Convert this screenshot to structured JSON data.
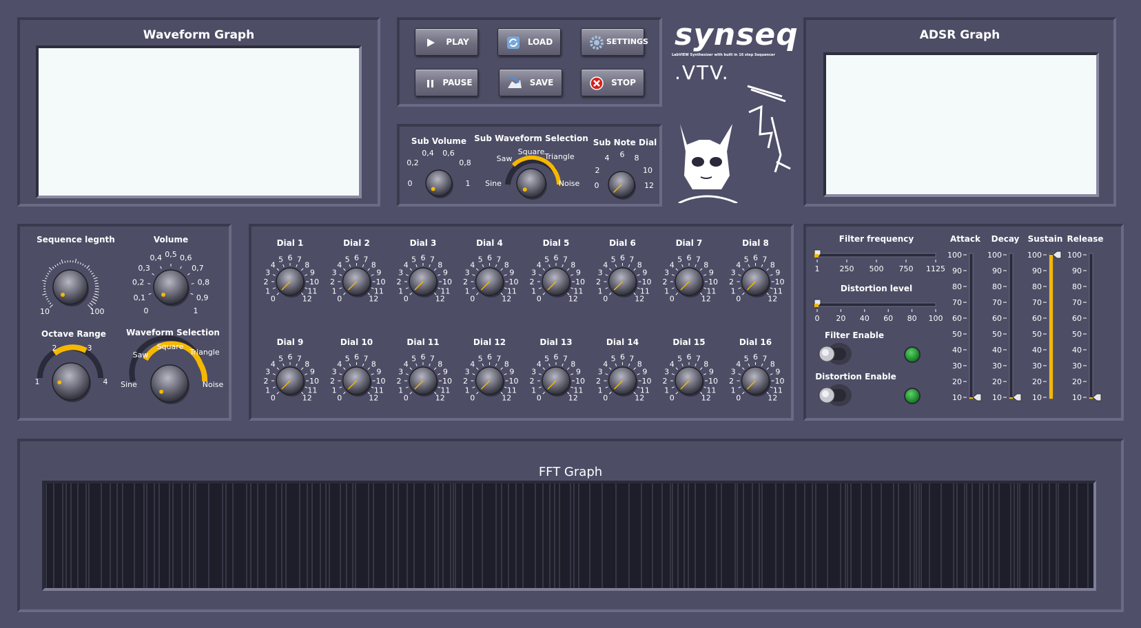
{
  "waveform_graph": {
    "title": "Waveform Graph"
  },
  "adsr_graph": {
    "title": "ADSR Graph"
  },
  "fft_graph": {
    "title": "FFT Graph"
  },
  "transport": {
    "play": "PLAY",
    "load": "LOAD",
    "settings": "SETTINGS",
    "pause": "PAUSE",
    "save": "SAVE",
    "stop": "STOP"
  },
  "logo": {
    "text": "synseq",
    "tagline": "LabVIEW Synthesizer with built in 16 step Sequencer",
    "mark": ".VTV."
  },
  "sub_controls": {
    "sub_volume": {
      "label": "Sub Volume",
      "ticks": [
        "0,2",
        "0,4",
        "0,6",
        "0,8"
      ],
      "min": "0",
      "max": "1",
      "value": 0
    },
    "sub_waveform": {
      "label": "Sub Waveform Selection",
      "options": [
        "Sine",
        "Saw",
        "Square",
        "Triangle",
        "Noise"
      ],
      "selected": "Sine"
    },
    "sub_note": {
      "label": "Sub Note Dial",
      "ticks": [
        "2",
        "4",
        "6",
        "8",
        "10"
      ],
      "min": "0",
      "max": "12",
      "value": 0
    }
  },
  "main_controls": {
    "sequence_length": {
      "label": "Sequence legnth",
      "min": "10",
      "max": "100",
      "value": 10
    },
    "volume": {
      "label": "Volume",
      "ticks": [
        "0,1",
        "0,2",
        "0,3",
        "0,4",
        "0,5",
        "0,6",
        "0,7",
        "0,8",
        "0,9"
      ],
      "min": "0",
      "max": "1",
      "value": 0
    },
    "octave_range": {
      "label": "Octave Range",
      "ticks": [
        "1",
        "2",
        "3",
        "4"
      ],
      "value": 1
    },
    "waveform_selection": {
      "label": "Waveform Selection",
      "options": [
        "Sine",
        "Saw",
        "Square",
        "Triangle",
        "Noise"
      ],
      "selected": "Sine"
    }
  },
  "dial_ticks": [
    "0",
    "1",
    "2",
    "3",
    "4",
    "5",
    "6",
    "7",
    "8",
    "9",
    "10",
    "11",
    "12"
  ],
  "dials": [
    {
      "label": "Dial 1",
      "value": 0
    },
    {
      "label": "Dial 2",
      "value": 0
    },
    {
      "label": "Dial 3",
      "value": 0
    },
    {
      "label": "Dial 4",
      "value": 0
    },
    {
      "label": "Dial 5",
      "value": 0
    },
    {
      "label": "Dial 6",
      "value": 0
    },
    {
      "label": "Dial 7",
      "value": 0
    },
    {
      "label": "Dial 8",
      "value": 0
    },
    {
      "label": "Dial 9",
      "value": 0
    },
    {
      "label": "Dial 10",
      "value": 0
    },
    {
      "label": "Dial 11",
      "value": 0
    },
    {
      "label": "Dial 12",
      "value": 0
    },
    {
      "label": "Dial 13",
      "value": 0
    },
    {
      "label": "Dial 14",
      "value": 0
    },
    {
      "label": "Dial 15",
      "value": 0
    },
    {
      "label": "Dial 16",
      "value": 0
    }
  ],
  "filters": {
    "filter_frequency": {
      "label": "Filter frequency",
      "ticks": [
        "1",
        "250",
        "500",
        "750",
        "1125"
      ],
      "value": 1
    },
    "distortion_level": {
      "label": "Distortion level",
      "ticks": [
        "0",
        "20",
        "40",
        "60",
        "80",
        "100"
      ],
      "value": 0
    },
    "filter_enable": {
      "label": "Filter Enable",
      "on": true
    },
    "distortion_enable": {
      "label": "Distortion Enable",
      "on": true
    }
  },
  "adsr_sliders": {
    "ticks": [
      "100",
      "90",
      "80",
      "70",
      "60",
      "50",
      "40",
      "30",
      "20",
      "10"
    ],
    "items": [
      {
        "label": "Attack",
        "value": 10
      },
      {
        "label": "Decay",
        "value": 10
      },
      {
        "label": "Sustain",
        "value": 100
      },
      {
        "label": "Release",
        "value": 10
      }
    ]
  },
  "colors": {
    "accent": "#f5b800",
    "panel": "#4d4d66",
    "screen": "#f4f9fa",
    "fft_bg": "#1e1e2a",
    "led": "#1e8c2c"
  }
}
